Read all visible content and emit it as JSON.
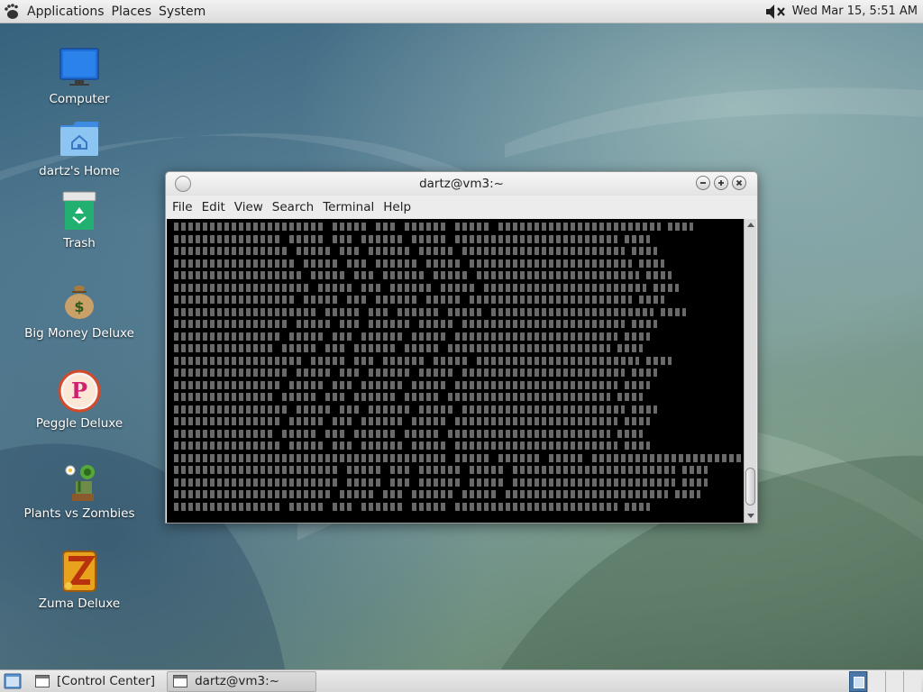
{
  "top_panel": {
    "menus": [
      "Applications",
      "Places",
      "System"
    ],
    "clock": "Wed Mar 15,  5:51 AM"
  },
  "desktop": {
    "icons": [
      {
        "label": "Computer"
      },
      {
        "label": "dartz's Home"
      },
      {
        "label": "Trash"
      },
      {
        "label": "Big Money Deluxe"
      },
      {
        "label": "Peggle Deluxe"
      },
      {
        "label": "Plants vs Zombies"
      },
      {
        "label": "Zuma Deluxe"
      }
    ]
  },
  "terminal": {
    "title": "dartz@vm3:~",
    "menus": [
      "File",
      "Edit",
      "View",
      "Search",
      "Terminal",
      "Help"
    ]
  },
  "bottom_panel": {
    "tasks": [
      "[Control Center]",
      "dartz@vm3:~"
    ]
  }
}
